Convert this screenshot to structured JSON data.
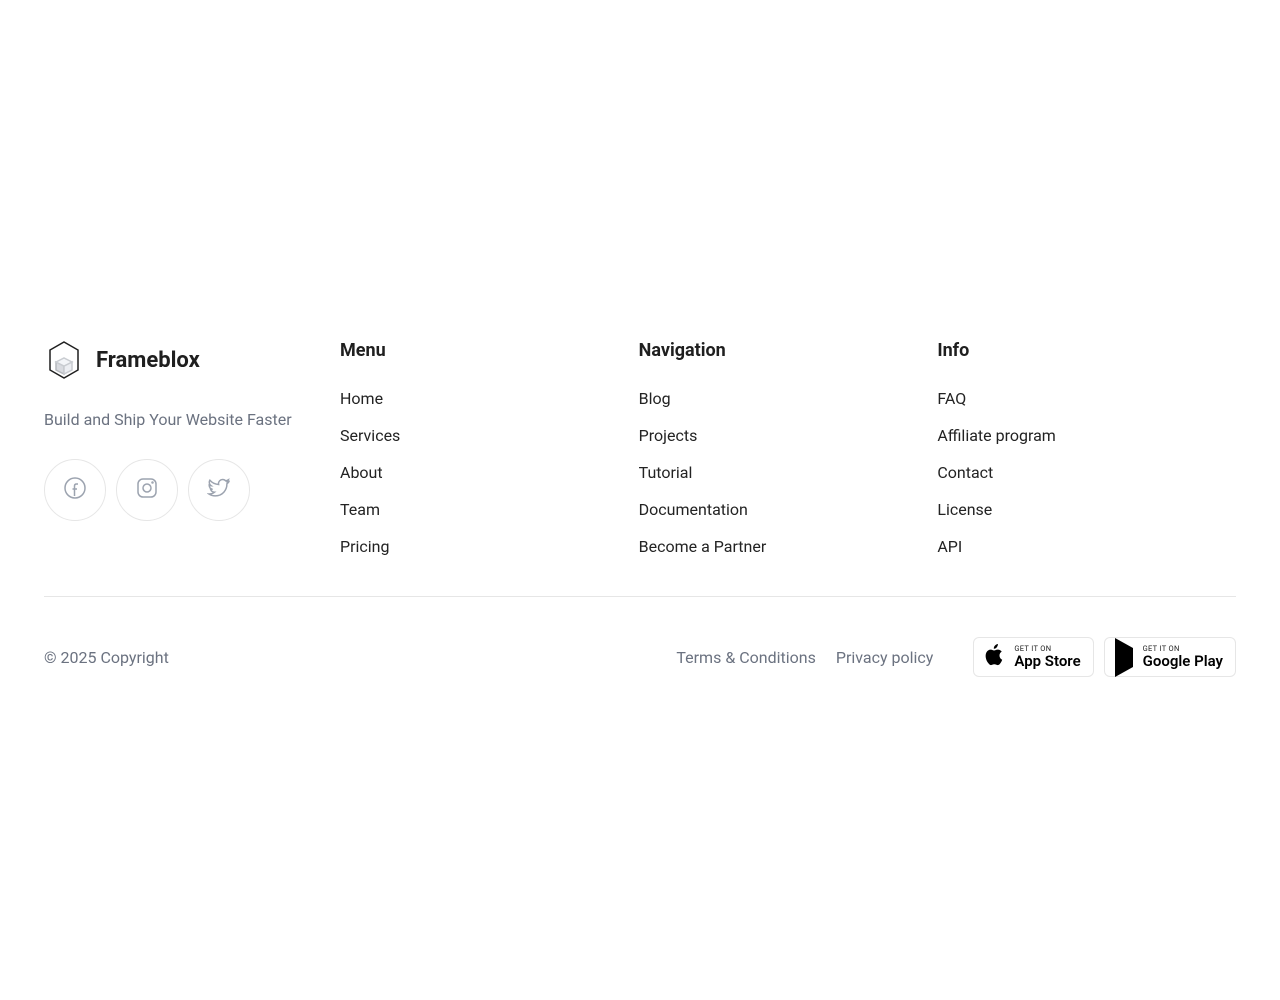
{
  "brand": {
    "name": "Frameblox",
    "tagline": "Build and Ship Your Website Faster"
  },
  "columns": [
    {
      "heading": "Menu",
      "items": [
        "Home",
        "Services",
        "About",
        "Team",
        "Pricing"
      ]
    },
    {
      "heading": "Navigation",
      "items": [
        "Blog",
        "Projects",
        "Tutorial",
        "Documentation",
        "Become a Partner"
      ]
    },
    {
      "heading": "Info",
      "items": [
        "FAQ",
        "Affiliate program",
        "Contact",
        "License",
        "API"
      ]
    }
  ],
  "bottom": {
    "copyright": "© 2025 Copyright",
    "links": [
      "Terms & Conditions",
      "Privacy policy"
    ],
    "appstore": {
      "small": "GET IT ON",
      "big": "App Store"
    },
    "googleplay": {
      "small": "GET IT ON",
      "big": "Google Play"
    }
  }
}
